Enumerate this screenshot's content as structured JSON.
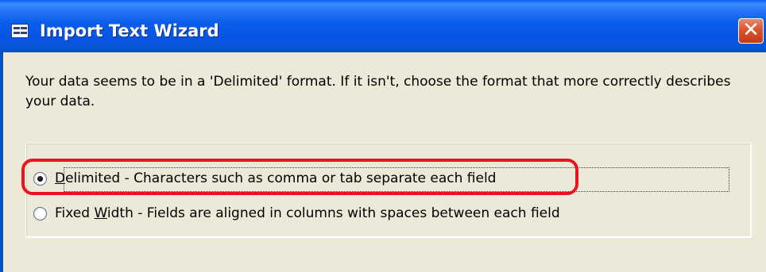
{
  "window": {
    "title": "Import Text Wizard",
    "close_glyph": "✕",
    "icon": "datasheet-icon"
  },
  "description": "Your data seems to be in a 'Delimited' format. If it isn't, choose the format that more correctly describes your data.",
  "format_options": [
    {
      "accel": "D",
      "rest": "elimited - Characters such as comma or tab separate each field",
      "selected": true
    },
    {
      "prefix": "Fixed ",
      "accel": "W",
      "rest": "idth - Fields are aligned in columns with spaces between each field",
      "selected": false
    }
  ],
  "colors": {
    "titlebar": "#0654E2",
    "dialog_bg": "#ECE9D8",
    "highlight": "#E8141E",
    "close_button": "#D9532C"
  }
}
